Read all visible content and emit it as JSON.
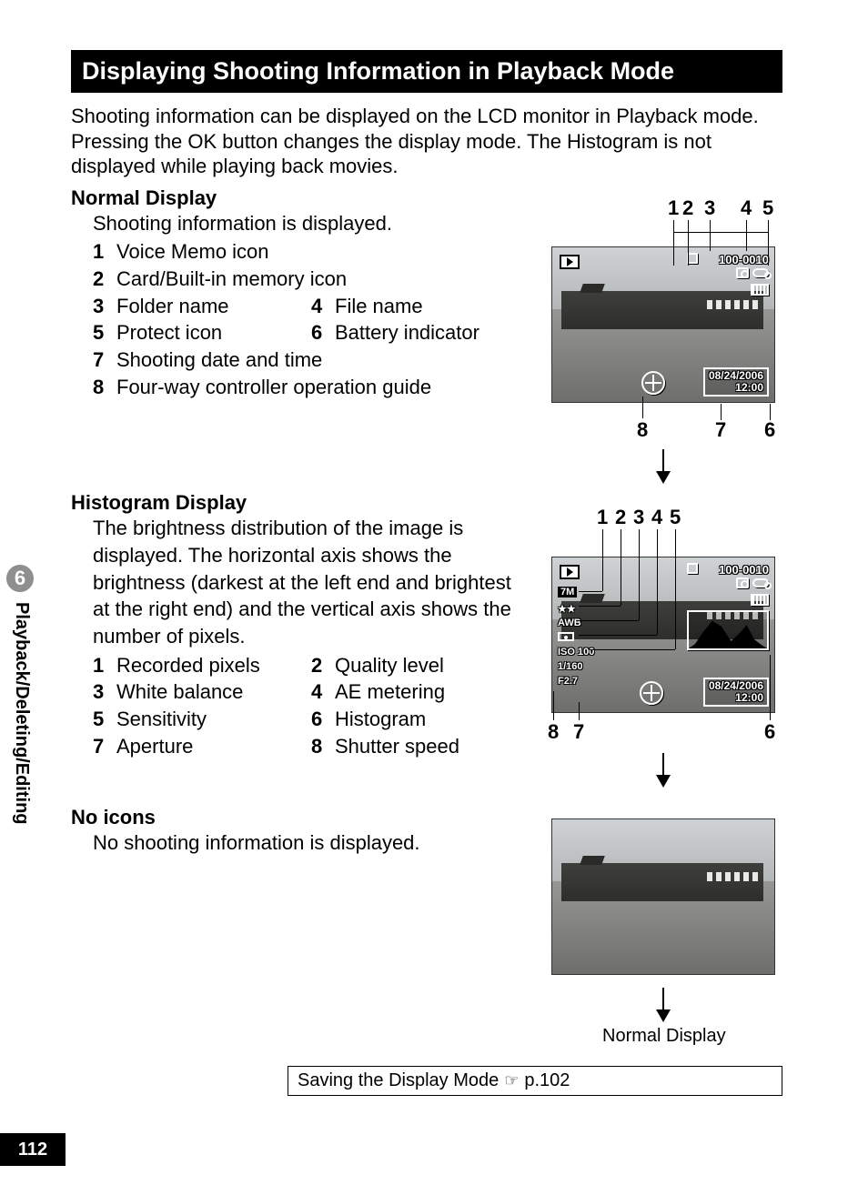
{
  "title": "Displaying Shooting Information in Playback Mode",
  "intro": "Shooting information can be displayed on the LCD monitor in Playback mode. Pressing the OK button changes the display mode. The Histogram is not displayed while playing back movies.",
  "sections": {
    "normal": {
      "heading": "Normal Display",
      "desc": "Shooting information is displayed.",
      "items": [
        {
          "n": "1",
          "t": "Voice Memo icon"
        },
        {
          "n": "2",
          "t": "Card/Built-in memory icon"
        },
        {
          "n": "3",
          "t": "Folder name"
        },
        {
          "n": "4",
          "t": "File name"
        },
        {
          "n": "5",
          "t": "Protect icon"
        },
        {
          "n": "6",
          "t": "Battery indicator"
        },
        {
          "n": "7",
          "t": "Shooting date and time"
        },
        {
          "n": "8",
          "t": "Four-way controller operation guide"
        }
      ]
    },
    "histogram": {
      "heading": "Histogram Display",
      "desc": "The brightness distribution of the image is displayed. The horizontal axis shows the brightness (darkest at the left end and brightest at the right end) and the vertical axis shows the number of pixels.",
      "items": [
        {
          "n": "1",
          "t": "Recorded pixels"
        },
        {
          "n": "2",
          "t": "Quality level"
        },
        {
          "n": "3",
          "t": "White balance"
        },
        {
          "n": "4",
          "t": "AE metering"
        },
        {
          "n": "5",
          "t": "Sensitivity"
        },
        {
          "n": "6",
          "t": "Histogram"
        },
        {
          "n": "7",
          "t": "Aperture"
        },
        {
          "n": "8",
          "t": "Shutter speed"
        }
      ]
    },
    "noicons": {
      "heading": "No icons",
      "desc": "No shooting information is displayed."
    }
  },
  "lcd": {
    "folder_file": "100-0010",
    "date": "08/24/2006",
    "time": "12:00",
    "hist": {
      "pixels": "7M",
      "quality": "★★",
      "wb": "AWB",
      "iso": "ISO 100",
      "shutter": "1/160",
      "aperture": "F2.7"
    }
  },
  "return_label": "Normal Display",
  "refbox": {
    "text": "Saving the Display Mode ",
    "ref": "p.102"
  },
  "sidebar": {
    "chapter": "6",
    "label": "Playback/Deleting/Editing"
  },
  "page_number": "112",
  "callouts_normal_top": [
    "1",
    "2",
    "3",
    "4",
    "5"
  ],
  "callouts_normal_bottom": [
    "8",
    "7",
    "6"
  ],
  "callouts_hist_top": [
    "1",
    "2",
    "3",
    "4",
    "5"
  ],
  "callouts_hist_bottom": [
    "8",
    "7",
    "6"
  ]
}
